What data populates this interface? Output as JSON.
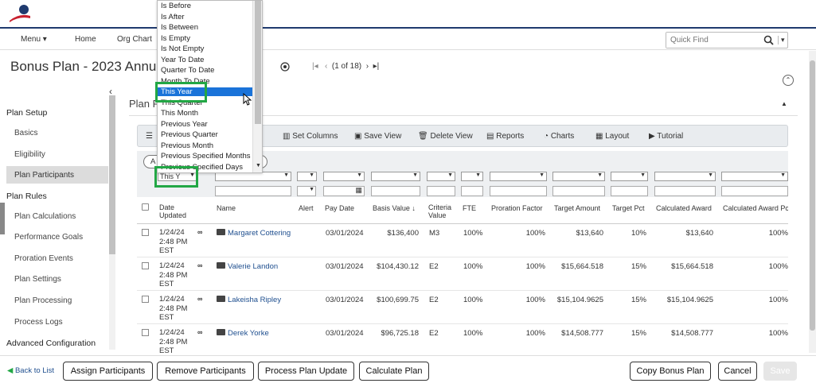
{
  "nav": {
    "menu": "Menu",
    "home": "Home",
    "org_chart": "Org Chart",
    "quick_find_placeholder": "Quick Find"
  },
  "page": {
    "title": "Bonus Plan - 2023 Annua",
    "pagination": "(1 of 18)",
    "section_title": "Plan P"
  },
  "sidebar": {
    "plan_setup": "Plan Setup",
    "basics": "Basics",
    "eligibility": "Eligibility",
    "plan_participants": "Plan Participants",
    "plan_rules": "Plan Rules",
    "plan_calculations": "Plan Calculations",
    "performance_goals": "Performance Goals",
    "proration_events": "Proration Events",
    "plan_settings": "Plan Settings",
    "plan_processing": "Plan Processing",
    "process_logs": "Process Logs",
    "advanced_configuration": "Advanced Configuration"
  },
  "toolbar": {
    "set_columns": "Set Columns",
    "save_view": "Save View",
    "delete_view": "Delete View",
    "reports": "Reports",
    "charts": "Charts",
    "layout": "Layout",
    "tutorial": "Tutorial"
  },
  "filter": {
    "date_filter_value": "This Y",
    "chip_label": "A"
  },
  "dropdown": {
    "items": [
      "Is Before",
      "Is After",
      "Is Between",
      "Is Empty",
      "Is Not Empty",
      "Year To Date",
      "Quarter To Date",
      "Month To Date",
      "This Year",
      "This Quarter",
      "This Month",
      "Previous Year",
      "Previous Quarter",
      "Previous Month",
      "Previous Specified Months",
      "Previous Specified Days"
    ],
    "selected": "This Year"
  },
  "columns": [
    "Date Updated",
    "Name",
    "Alert",
    "Pay Date",
    "Basis Value",
    "Criteria Value",
    "FTE",
    "Proration Factor",
    "Target Amount",
    "Target Pct",
    "Calculated Award",
    "Calculated Award Pc"
  ],
  "rows": [
    {
      "date": "1/24/24",
      "time": "2:48 PM",
      "tz": "EST",
      "name": "Margaret Cottering",
      "pay_date": "03/01/2024",
      "basis": "$136,400",
      "criteria": "M3",
      "fte": "100%",
      "proration": "100%",
      "target_amount": "$13,640",
      "target_pct": "10%",
      "calc_award": "$13,640",
      "calc_pct": "100%"
    },
    {
      "date": "1/24/24",
      "time": "2:48 PM",
      "tz": "EST",
      "name": "Valerie Landon",
      "pay_date": "03/01/2024",
      "basis": "$104,430.12",
      "criteria": "E2",
      "fte": "100%",
      "proration": "100%",
      "target_amount": "$15,664.518",
      "target_pct": "15%",
      "calc_award": "$15,664.518",
      "calc_pct": "100%"
    },
    {
      "date": "1/24/24",
      "time": "2:48 PM",
      "tz": "EST",
      "name": "Lakeisha Ripley",
      "pay_date": "03/01/2024",
      "basis": "$100,699.75",
      "criteria": "E2",
      "fte": "100%",
      "proration": "100%",
      "target_amount": "$15,104.9625",
      "target_pct": "15%",
      "calc_award": "$15,104.9625",
      "calc_pct": "100%"
    },
    {
      "date": "1/24/24",
      "time": "2:48 PM",
      "tz": "EST",
      "name": "Derek Yorke",
      "pay_date": "03/01/2024",
      "basis": "$96,725.18",
      "criteria": "E2",
      "fte": "100%",
      "proration": "100%",
      "target_amount": "$14,508.777",
      "target_pct": "15%",
      "calc_award": "$14,508.777",
      "calc_pct": "100%"
    }
  ],
  "footer": {
    "back": "Back to List",
    "assign": "Assign Participants",
    "remove": "Remove Participants",
    "process": "Process Plan Update",
    "calculate": "Calculate Plan",
    "copy": "Copy Bonus Plan",
    "cancel": "Cancel",
    "save": "Save"
  },
  "colors": {
    "brand_blue": "#1f3a6e",
    "brand_red": "#c8202f",
    "highlight": "#1a73d9",
    "callout_green": "#22a745",
    "link": "#1f4f8f"
  }
}
